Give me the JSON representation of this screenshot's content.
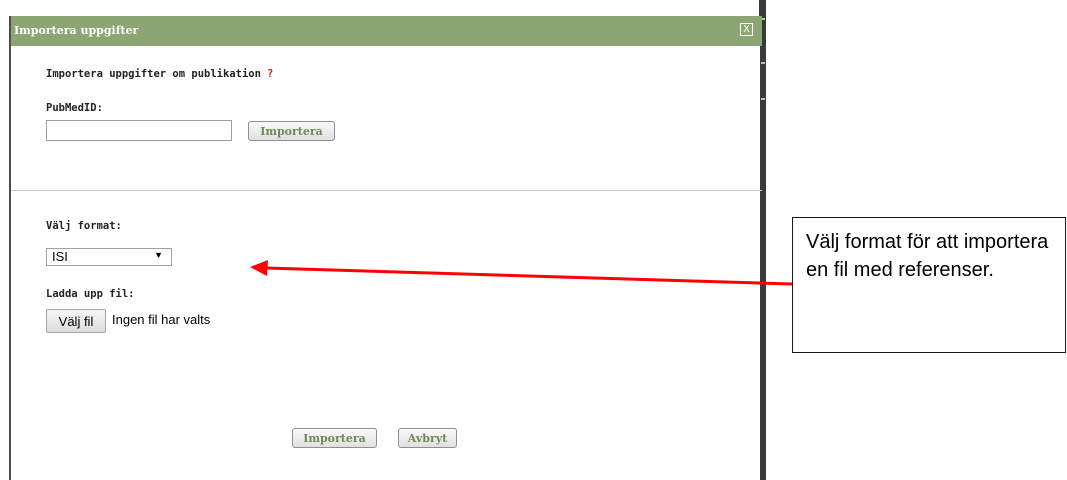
{
  "dialog": {
    "title": "Importera uppgifter",
    "close_icon": "close-icon",
    "close_glyph": "X"
  },
  "pubmed_section": {
    "heading": "Importera uppgifter om publikation",
    "help_mark": "?",
    "field_label": "PubMedID:",
    "input_value": "",
    "import_button": "Importera"
  },
  "file_section": {
    "format_label": "Välj format:",
    "format_selected": "ISI",
    "upload_label": "Ladda upp fil:",
    "choose_file_button": "Välj fil",
    "file_status": "Ingen fil har valts"
  },
  "footer": {
    "import_button": "Importera",
    "cancel_button": "Avbryt"
  },
  "annotation": {
    "callout_text": "Välj format för att importera en fil med referenser.",
    "arrow_color": "#ff0000"
  },
  "colors": {
    "titlebar": "#8ba673",
    "button_text": "#6e8a55",
    "help_mark": "#c0241f"
  }
}
